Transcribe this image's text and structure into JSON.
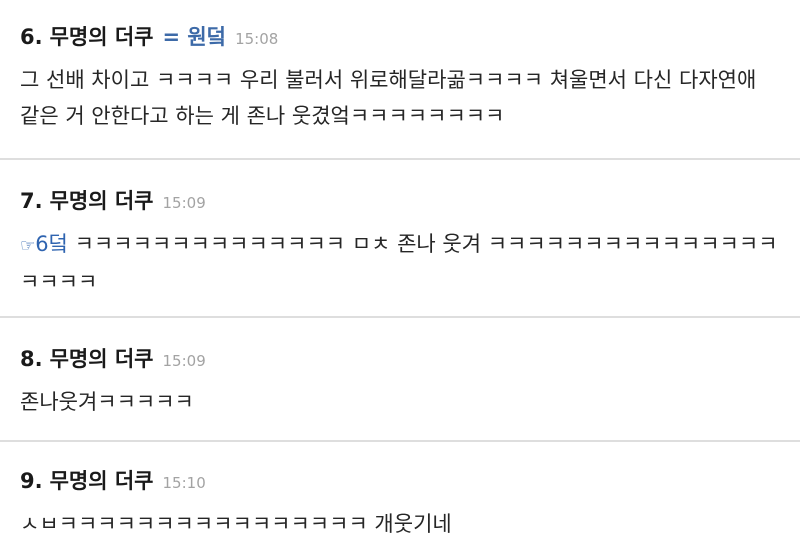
{
  "comments": [
    {
      "number": "6.",
      "author": "무명의 더쿠",
      "op_mark": "= 원덬",
      "time": "15:08",
      "text": "그 선배 차이고 ㅋㅋㅋㅋ 우리 불러서 위로해달라곪ㅋㅋㅋㅋ 쳐울면서 다신 다자연애 같은 거 안한다고 하는 게 존나 웃겼엌ㅋㅋㅋㅋㅋㅋㅋㅋ"
    },
    {
      "number": "7.",
      "author": "무명의 더쿠",
      "time": "15:09",
      "reply_ref": "6덬",
      "reply_icon": "hand-pointing-right-icon",
      "reply_glyph": "☞",
      "text": " ㅋㅋㅋㅋㅋㅋㅋㅋㅋㅋㅋㅋㅋㅋ ㅁㅊ 존나 웃겨 ㅋㅋㅋㅋㅋㅋㅋㅋㅋㅋㅋㅋㅋㅋㅋㅋㅋㅋㅋ"
    },
    {
      "number": "8.",
      "author": "무명의 더쿠",
      "time": "15:09",
      "text": "존나웃겨ㅋㅋㅋㅋㅋ"
    },
    {
      "number": "9.",
      "author": "무명의 더쿠",
      "time": "15:10",
      "text": "ㅅㅂㅋㅋㅋㅋㅋㅋㅋㅋㅋㅋㅋㅋㅋㅋㅋㅋ 개웃기네"
    }
  ],
  "colors": {
    "op_mark": "#3d6aa8",
    "reply_link": "#2f64b0",
    "timestamp": "#a3a3a3",
    "divider": "#dedede"
  }
}
